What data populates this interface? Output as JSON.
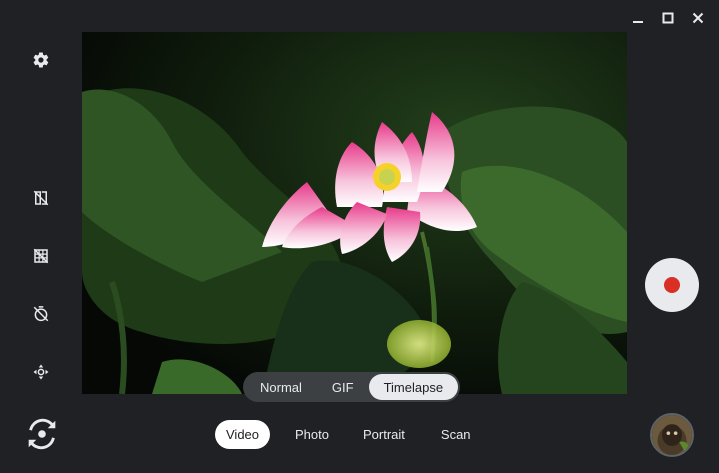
{
  "window": {
    "icons": [
      "minimize-icon",
      "maximize-icon",
      "close-icon"
    ]
  },
  "left_rail": {
    "icons": [
      "settings-icon",
      "mirror-icon",
      "grid-icon",
      "timer-icon",
      "ptz-icon"
    ]
  },
  "submodes": {
    "items": [
      {
        "label": "Normal",
        "active": false
      },
      {
        "label": "GIF",
        "active": false
      },
      {
        "label": "Timelapse",
        "active": true
      }
    ]
  },
  "modes": {
    "items": [
      {
        "label": "Video",
        "active": true
      },
      {
        "label": "Photo",
        "active": false
      },
      {
        "label": "Portrait",
        "active": false
      },
      {
        "label": "Scan",
        "active": false
      }
    ]
  },
  "shutter": {
    "icon": "record-icon",
    "accent": "#d93025"
  },
  "switch_camera": {
    "icon": "switch-camera-icon"
  },
  "gallery": {
    "icon": "gallery-thumbnail"
  },
  "colors": {
    "background": "#202124",
    "active_pill": "#e8eaed",
    "record": "#d93025"
  }
}
